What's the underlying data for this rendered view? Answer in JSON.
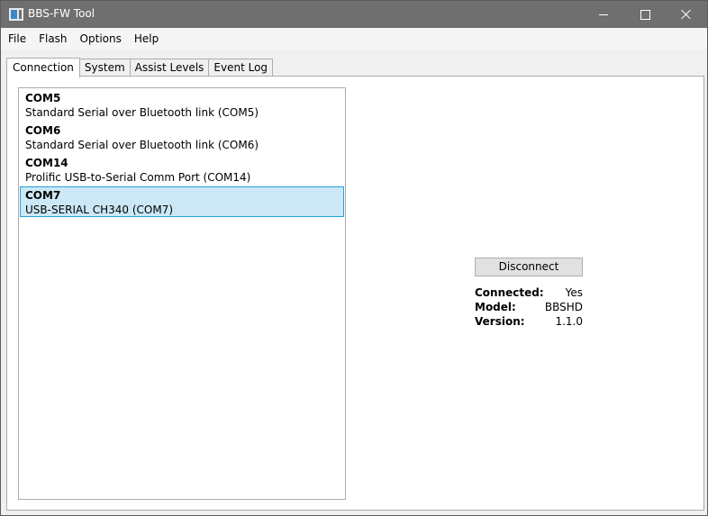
{
  "window": {
    "title": "BBS-FW Tool"
  },
  "menu": [
    "File",
    "Flash",
    "Options",
    "Help"
  ],
  "tabs": [
    "Connection",
    "System",
    "Assist Levels",
    "Event Log"
  ],
  "ports": [
    {
      "name": "COM5",
      "description": "Standard Serial over Bluetooth link (COM5)",
      "selected": false
    },
    {
      "name": "COM6",
      "description": "Standard Serial over Bluetooth link (COM6)",
      "selected": false
    },
    {
      "name": "COM14",
      "description": "Prolific USB-to-Serial Comm Port (COM14)",
      "selected": false
    },
    {
      "name": "COM7",
      "description": "USB-SERIAL CH340 (COM7)",
      "selected": true
    }
  ],
  "connection": {
    "button_label": "Disconnect",
    "status": [
      {
        "label": "Connected:",
        "value": "Yes"
      },
      {
        "label": "Model:",
        "value": "BBSHD"
      },
      {
        "label": "Version:",
        "value": "1.1.0"
      }
    ]
  },
  "colors": {
    "titlebar": "#6f6f6f",
    "selection": "#cce8f7",
    "selection_border": "#26a0da"
  }
}
